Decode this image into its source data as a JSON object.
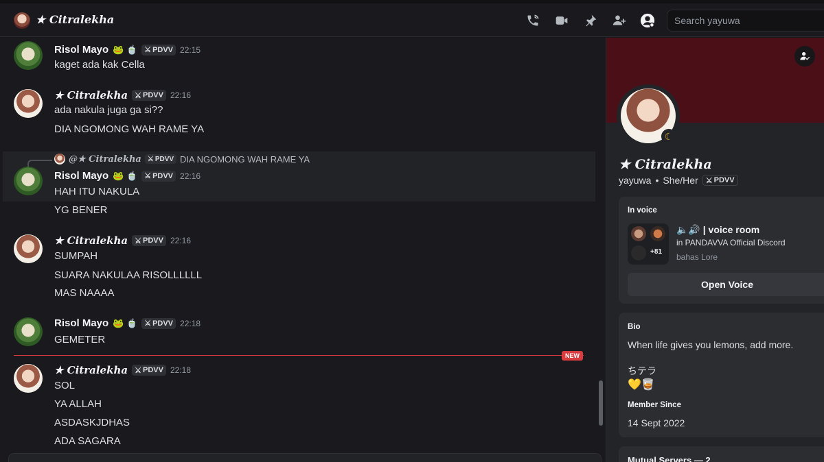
{
  "header": {
    "title": "★ Citralekha",
    "search_placeholder": "Search yayuwa",
    "icons": [
      "voice-call-icon",
      "video-call-icon",
      "pin-icon",
      "add-friends-icon",
      "user-profile-icon"
    ]
  },
  "colors": {
    "background": "#1a1a1e",
    "panel": "#232428",
    "banner": "#4a0f17",
    "new_divider": "#d83c3e",
    "text": "#dbdee1"
  },
  "messages": [
    {
      "author": "Risol Mayo",
      "emojis": "🐸 🍵",
      "tag": "PDVV",
      "time": "22:15",
      "lines": [
        "kaget ada kak Cella"
      ]
    },
    {
      "author": "★ Citralekha",
      "tag": "PDVV",
      "time": "22:16",
      "lines": [
        "ada nakula juga ga si??",
        "DIA NGOMONG WAH RAME YA"
      ]
    },
    {
      "author": "Risol Mayo",
      "emojis": "🐸 🍵",
      "tag": "PDVV",
      "time": "22:16",
      "reply": {
        "at": "@★ Citralekha",
        "tag": "PDVV",
        "text": "DIA NGOMONG WAH RAME YA"
      },
      "lines": [
        "HAH ITU NAKULA",
        "YG BENER"
      ]
    },
    {
      "author": "★ Citralekha",
      "tag": "PDVV",
      "time": "22:16",
      "lines": [
        "SUMPAH",
        "SUARA NAKULAA RISOLLLLLL",
        "MAS NAAAA"
      ]
    },
    {
      "author": "Risol Mayo",
      "emojis": "🐸 🍵",
      "tag": "PDVV",
      "time": "22:18",
      "lines": [
        "GEMETER"
      ]
    },
    {
      "author": "★ Citralekha",
      "tag": "PDVV",
      "time": "22:18",
      "lines": [
        "SOL",
        "YA ALLAH",
        "ASDASKJDHAS",
        "ADA SAGARA"
      ]
    }
  ],
  "new_badge": "NEW",
  "profile": {
    "display_name": "★ Citralekha",
    "username": "yayuwa",
    "separator": "•",
    "pronouns": "She/Her",
    "tag": "PDVV",
    "status": "idle",
    "in_voice": {
      "title": "In voice",
      "room": "🔈🔊 | voice room",
      "server": "in PANDAVVA Official Discord",
      "sub": "bahas Lore",
      "count": "+81",
      "button": "Open Voice"
    },
    "bio": {
      "title": "Bio",
      "text": "When life gives you lemons, add more.",
      "extra": "ちテラ",
      "emoji": "💛🥃"
    },
    "member_since": {
      "title": "Member Since",
      "date": "14 Sept 2022"
    },
    "mutual": "Mutual Servers — 2"
  }
}
